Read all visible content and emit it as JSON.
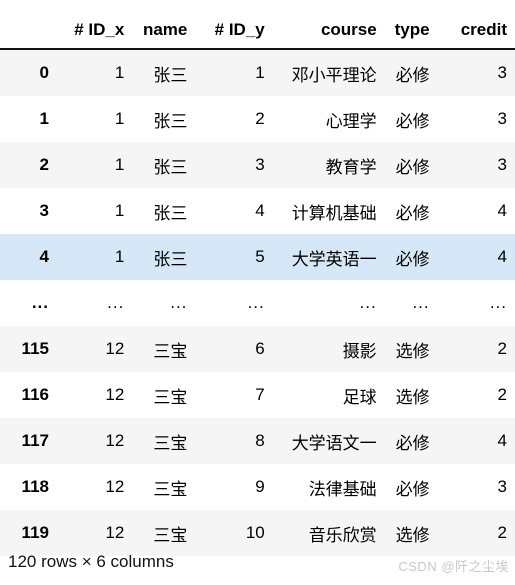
{
  "table": {
    "index_header": "",
    "columns": [
      "# ID_x",
      "name",
      "# ID_y",
      "course",
      "type",
      "credit"
    ],
    "rows": [
      {
        "index": "0",
        "style": "stripe",
        "cells": [
          "1",
          "张三",
          "1",
          "邓小平理论",
          "必修",
          "3"
        ]
      },
      {
        "index": "1",
        "style": "plain",
        "cells": [
          "1",
          "张三",
          "2",
          "心理学",
          "必修",
          "3"
        ]
      },
      {
        "index": "2",
        "style": "stripe",
        "cells": [
          "1",
          "张三",
          "3",
          "教育学",
          "必修",
          "3"
        ]
      },
      {
        "index": "3",
        "style": "plain",
        "cells": [
          "1",
          "张三",
          "4",
          "计算机基础",
          "必修",
          "4"
        ]
      },
      {
        "index": "4",
        "style": "hl",
        "cells": [
          "1",
          "张三",
          "5",
          "大学英语一",
          "必修",
          "4"
        ]
      },
      {
        "index": "...",
        "style": "ellipsis",
        "cells": [
          "...",
          "...",
          "...",
          "...",
          "...",
          "..."
        ]
      },
      {
        "index": "115",
        "style": "stripe",
        "cells": [
          "12",
          "三宝",
          "6",
          "摄影",
          "选修",
          "2"
        ]
      },
      {
        "index": "116",
        "style": "plain",
        "cells": [
          "12",
          "三宝",
          "7",
          "足球",
          "选修",
          "2"
        ]
      },
      {
        "index": "117",
        "style": "stripe",
        "cells": [
          "12",
          "三宝",
          "8",
          "大学语文一",
          "必修",
          "4"
        ]
      },
      {
        "index": "118",
        "style": "plain",
        "cells": [
          "12",
          "三宝",
          "9",
          "法律基础",
          "必修",
          "3"
        ]
      },
      {
        "index": "119",
        "style": "stripe",
        "cells": [
          "12",
          "三宝",
          "10",
          "音乐欣赏",
          "选修",
          "2"
        ]
      }
    ]
  },
  "footer": {
    "shape": "120 rows × 6 columns",
    "watermark": "CSDN @阡之尘埃"
  },
  "colors": {
    "stripe_row": "#f5f5f5",
    "highlight_row": "#d6e8f7",
    "header_rule": "#111111",
    "text": "#000000",
    "watermark_text": "#c8c8c8"
  }
}
